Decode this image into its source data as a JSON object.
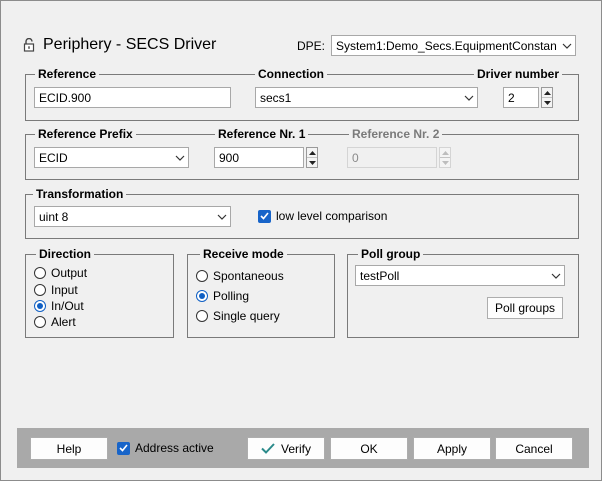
{
  "header": {
    "title": "Periphery - SECS Driver",
    "dpe_label": "DPE:",
    "dpe_value": "System1:Demo_Secs.EquipmentConstan"
  },
  "reference": {
    "label": "Reference",
    "value": "ECID.900"
  },
  "connection": {
    "label": "Connection",
    "value": "secs1"
  },
  "driver_number": {
    "label": "Driver number",
    "value": "2"
  },
  "reference_prefix": {
    "label": "Reference Prefix",
    "value": "ECID"
  },
  "reference_nr1": {
    "label": "Reference Nr. 1",
    "value": "900"
  },
  "reference_nr2": {
    "label": "Reference Nr. 2",
    "value": "0"
  },
  "transformation": {
    "label": "Transformation",
    "value": "uint 8",
    "low_level_label": "low level comparison",
    "low_level_checked": true
  },
  "direction": {
    "label": "Direction",
    "options": [
      "Output",
      "Input",
      "In/Out",
      "Alert"
    ],
    "selected": "In/Out"
  },
  "receive_mode": {
    "label": "Receive mode",
    "options": [
      "Spontaneous",
      "Polling",
      "Single query"
    ],
    "selected": "Polling"
  },
  "poll_group": {
    "label": "Poll group",
    "value": "testPoll",
    "button_label": "Poll groups"
  },
  "footer": {
    "help_label": "Help",
    "address_active_label": "Address active",
    "address_active_checked": true,
    "verify_label": "Verify",
    "ok_label": "OK",
    "apply_label": "Apply",
    "cancel_label": "Cancel"
  },
  "colors": {
    "accent": "#1764c9",
    "verify_check": "#2a8a8a",
    "background": "#f0f0f0",
    "footer_bar": "#a9a9a9"
  }
}
